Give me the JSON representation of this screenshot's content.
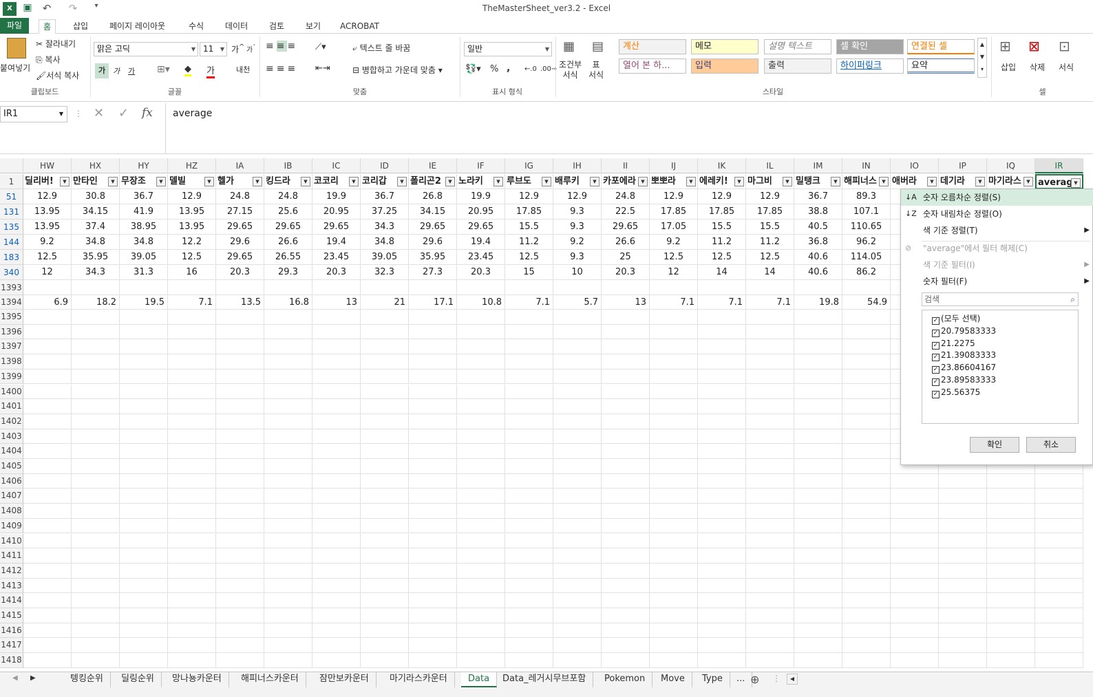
{
  "window": {
    "title": "TheMasterSheet_ver3.2 - Excel"
  },
  "ribbon_tabs": [
    "파일",
    "홈",
    "삽입",
    "페이지 레이아웃",
    "수식",
    "데이터",
    "검토",
    "보기",
    "ACROBAT"
  ],
  "clipboard": {
    "paste": "붙여넣기",
    "cut": "잘라내기",
    "copy": "복사",
    "format_painter": "서식 복사",
    "label": "클립보드"
  },
  "font": {
    "name": "맑은 고딕",
    "size": "11",
    "grow": "가",
    "shrink": "가",
    "bold": "가",
    "italic": "가",
    "underline": "가",
    "label": "글꼴",
    "font_color_glyph": "가",
    "phonetic": "내천"
  },
  "alignment": {
    "wrap": "텍스트 줄 바꿈",
    "merge": "병합하고 가운데 맞춤",
    "label": "맞춤"
  },
  "number": {
    "format": "일반",
    "percent": "%",
    "comma": ",",
    "dec_inc": ".00\n→.0",
    "label": "표시 형식"
  },
  "styles": {
    "conditional": "조건부\n서식",
    "table": "표\n서식",
    "cells": [
      {
        "text": "계산",
        "color": "#fa7d00",
        "bg": "#f2f2f2"
      },
      {
        "text": "메모",
        "color": "#222",
        "bg": "#ffffcc"
      },
      {
        "text": "설명 텍스트",
        "color": "#7f7f7f",
        "bg": "#ffffff"
      },
      {
        "text": "셀 확인",
        "color": "#ffffff",
        "bg": "#a5a5a5"
      },
      {
        "text": "연결된 셀",
        "color": "#fa7d00",
        "bg": "#ffffff"
      },
      {
        "text": "열어 본 하...",
        "color": "#954f72",
        "bg": "#ffffff"
      },
      {
        "text": "입력",
        "color": "#3f3f76",
        "bg": "#ffcc99"
      },
      {
        "text": "출력",
        "color": "#3f3f3f",
        "bg": "#f2f2f2"
      },
      {
        "text": "하이퍼링크",
        "color": "#0563c1",
        "bg": "#ffffff"
      },
      {
        "text": "요약",
        "color": "#222",
        "bg": "#ffffff"
      }
    ],
    "label": "스타일"
  },
  "cells_group": {
    "insert": "삽입",
    "delete": "삭제",
    "format": "서식",
    "label": "셀"
  },
  "formula_bar": {
    "name_box": "IR1",
    "value": "average"
  },
  "columns": [
    "HW",
    "HX",
    "HY",
    "HZ",
    "IA",
    "IB",
    "IC",
    "ID",
    "IE",
    "IF",
    "IG",
    "IH",
    "II",
    "IJ",
    "IK",
    "IL",
    "IM",
    "IN",
    "IO",
    "IP",
    "IQ",
    "IR"
  ],
  "header_row": {
    "num": "1",
    "cells": [
      "딜리버!",
      "만타인",
      "무장조",
      "델빌",
      "헬가",
      "킹드라",
      "코코리",
      "코리갑",
      "폴리곤2",
      "노라키",
      "루브도",
      "배루키",
      "카포에라",
      "뽀뽀라",
      "에레키!",
      "마그비",
      "밀탱크",
      "해피너스",
      "애버라",
      "데기라",
      "마기라스",
      "average"
    ]
  },
  "rows": [
    {
      "num": "51",
      "blue": true,
      "cells": [
        "12.9",
        "30.8",
        "36.7",
        "12.9",
        "24.8",
        "24.8",
        "19.9",
        "36.7",
        "26.8",
        "19.9",
        "12.9",
        "12.9",
        "24.8",
        "12.9",
        "12.9",
        "12.9",
        "36.7",
        "89.3"
      ]
    },
    {
      "num": "131",
      "blue": true,
      "cells": [
        "13.95",
        "34.15",
        "41.9",
        "13.95",
        "27.15",
        "25.6",
        "20.95",
        "37.25",
        "34.15",
        "20.95",
        "17.85",
        "9.3",
        "22.5",
        "17.85",
        "17.85",
        "17.85",
        "38.8",
        "107.1"
      ]
    },
    {
      "num": "135",
      "blue": true,
      "cells": [
        "13.95",
        "37.4",
        "38.95",
        "13.95",
        "29.65",
        "29.65",
        "29.65",
        "34.3",
        "29.65",
        "29.65",
        "15.5",
        "9.3",
        "29.65",
        "17.05",
        "15.5",
        "15.5",
        "40.5",
        "110.65"
      ]
    },
    {
      "num": "144",
      "blue": true,
      "cells": [
        "9.2",
        "34.8",
        "34.8",
        "12.2",
        "29.6",
        "26.6",
        "19.4",
        "34.8",
        "29.6",
        "19.4",
        "11.2",
        "9.2",
        "26.6",
        "9.2",
        "11.2",
        "11.2",
        "36.8",
        "96.2"
      ]
    },
    {
      "num": "183",
      "blue": true,
      "cells": [
        "12.5",
        "35.95",
        "39.05",
        "12.5",
        "29.65",
        "26.55",
        "23.45",
        "39.05",
        "35.95",
        "23.45",
        "12.5",
        "9.3",
        "25",
        "12.5",
        "12.5",
        "12.5",
        "40.6",
        "114.05"
      ]
    },
    {
      "num": "340",
      "blue": true,
      "cells": [
        "12",
        "34.3",
        "31.3",
        "16",
        "20.3",
        "29.3",
        "20.3",
        "32.3",
        "27.3",
        "20.3",
        "15",
        "10",
        "20.3",
        "12",
        "14",
        "14",
        "40.6",
        "86.2"
      ]
    }
  ],
  "row_1393": {
    "num": "1393"
  },
  "row_1394": {
    "num": "1394",
    "cells": [
      "6.9",
      "18.2",
      "19.5",
      "7.1",
      "13.5",
      "16.8",
      "13",
      "21",
      "17.1",
      "10.8",
      "7.1",
      "5.7",
      "13",
      "7.1",
      "7.1",
      "7.1",
      "19.8",
      "54.9"
    ]
  },
  "empty_rows": [
    "1395",
    "1396",
    "1397",
    "1398",
    "1399",
    "1400",
    "1401",
    "1402",
    "1403",
    "1404",
    "1405",
    "1406",
    "1407",
    "1408",
    "1409",
    "1410",
    "1411",
    "1412",
    "1413",
    "1414",
    "1415",
    "1416",
    "1417",
    "1418"
  ],
  "filter_panel": {
    "sort_asc": "숫자 오름차순 정렬(S)",
    "sort_desc": "숫자 내림차순 정렬(O)",
    "sort_color": "색 기준 정렬(T)",
    "clear": "\"average\"에서 필터 해제(C)",
    "filter_color": "색 기준 필터(I)",
    "number_filter": "숫자 필터(F)",
    "search_placeholder": "검색",
    "items": [
      "(모두 선택)",
      "20.79583333",
      "21.2275",
      "21.39083333",
      "23.86604167",
      "23.89583333",
      "25.56375"
    ],
    "ok": "확인",
    "cancel": "취소"
  },
  "sheet_tabs": [
    "텡킹순위",
    "딜링순위",
    "망나뇽카운터",
    "해피너스카운터",
    "잠만보카운터",
    "마기라스카운터",
    "Data",
    "Data_레거시무브포함",
    "Pokemon",
    "Move",
    "Type",
    "..."
  ],
  "active_sheet": "Data"
}
